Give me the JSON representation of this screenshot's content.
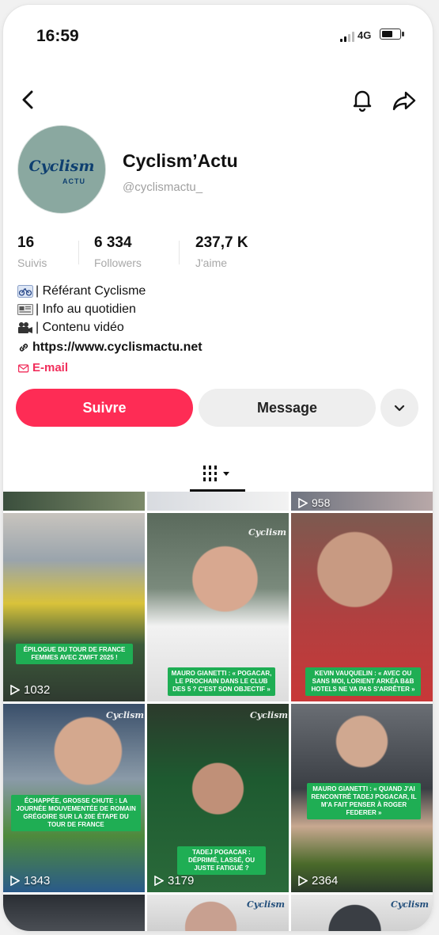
{
  "status_bar": {
    "time": "16:59",
    "network": "4G"
  },
  "profile": {
    "avatar_text": "Cyclism",
    "avatar_subtext": "ACTU",
    "name": "Cyclism’Actu",
    "handle": "@cyclismactu_",
    "stats": [
      {
        "value": "16",
        "label": "Suivis"
      },
      {
        "value": "6 334",
        "label": "Followers"
      },
      {
        "value": "237,7 K",
        "label": "J'aime"
      }
    ],
    "bio": [
      {
        "icon": "bicycle-icon",
        "text": "| Référant Cyclisme"
      },
      {
        "icon": "newspaper-icon",
        "text": "| Info au quotidien"
      },
      {
        "icon": "video-camera-icon",
        "text": "| Contenu vidéo"
      }
    ],
    "link": "https://www.cyclismactu.net",
    "email_label": "E-mail"
  },
  "actions": {
    "follow_label": "Suivre",
    "message_label": "Message"
  },
  "colors": {
    "accent": "#fe2c55",
    "caption_green": "#1fae54",
    "avatar_bg": "#8aa8a0"
  },
  "videos": [
    {
      "views": "",
      "caption": "",
      "watermark": ""
    },
    {
      "views": "",
      "caption": "",
      "watermark": ""
    },
    {
      "views": "958",
      "caption": "",
      "watermark": ""
    },
    {
      "views": "1032",
      "caption": "Épilogue du Tour de France Femmes avec Zwift 2025 !",
      "watermark": ""
    },
    {
      "views": "",
      "caption": "Mauro Gianetti : « Pogacar, le prochain dans le club des 5 ? C'est son objectif »",
      "watermark": "Cyclism"
    },
    {
      "views": "",
      "caption": "Kevin Vauquelin : « Avec ou sans moi, Lorient Arkéa B&B Hotels ne va pas s'arrêter »",
      "watermark": ""
    },
    {
      "views": "1343",
      "caption": "Échappée, grosse chute : la journée mouvementée de Romain Grégoire sur la 20e étape du Tour de France",
      "watermark": "Cyclism"
    },
    {
      "views": "3179",
      "caption": "Tadej Pogacar : déprimé, lassé, ou juste fatigué ?",
      "watermark": "Cyclism"
    },
    {
      "views": "2364",
      "caption": "Mauro Gianetti : « Quand j'ai rencontré Tadej Pogacar, il m'a fait penser à Roger Federer »",
      "watermark": ""
    },
    {
      "views": "",
      "caption": "",
      "watermark": ""
    },
    {
      "views": "",
      "caption": "",
      "watermark": "Cyclism"
    },
    {
      "views": "",
      "caption": "",
      "watermark": "Cyclism"
    }
  ]
}
